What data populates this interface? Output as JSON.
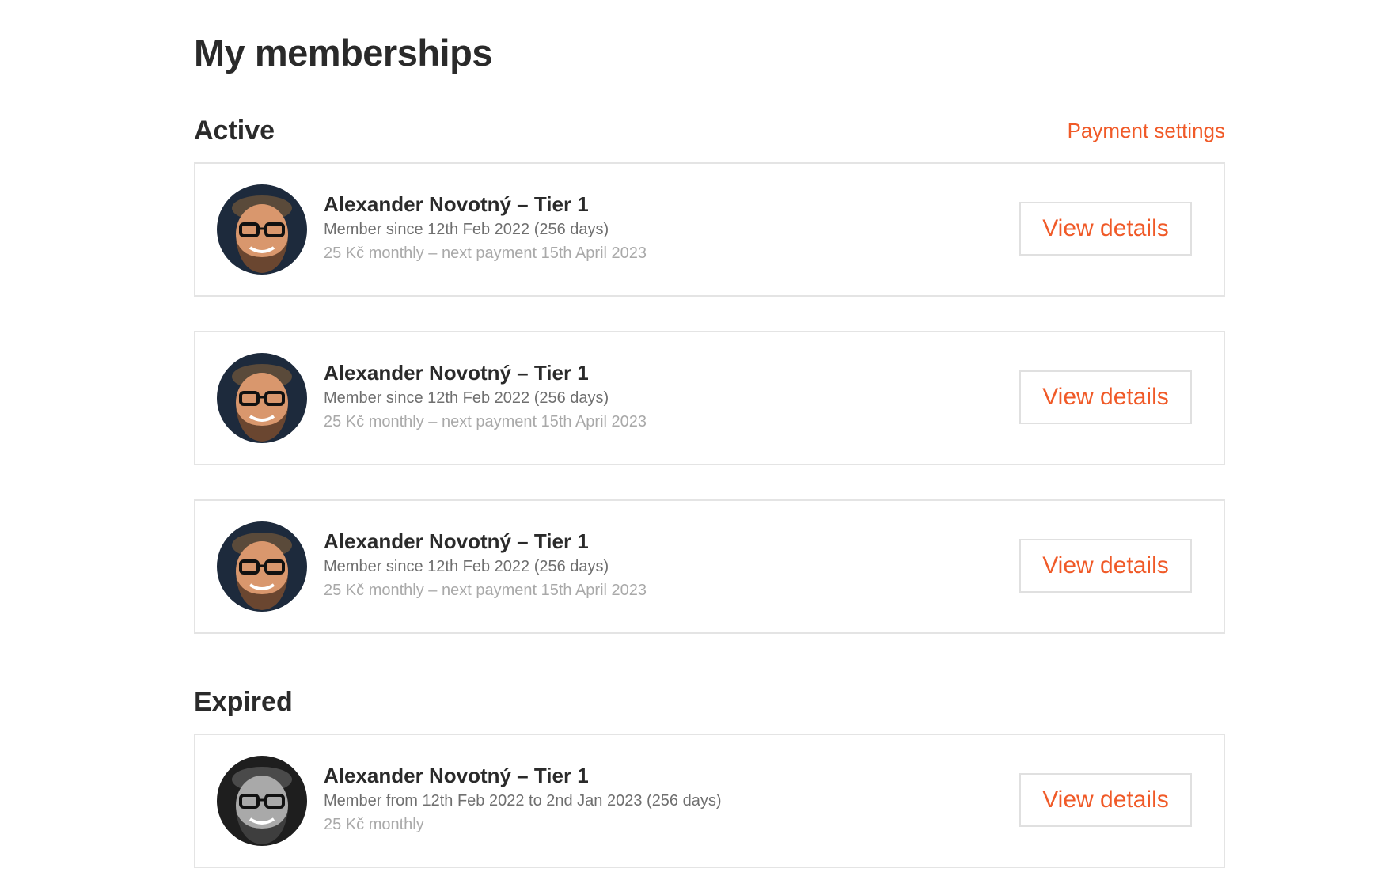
{
  "page_title": "My memberships",
  "active": {
    "title": "Active",
    "payment_settings_label": "Payment settings",
    "memberships": [
      {
        "name": "Alexander Novotný – Tier 1",
        "since": "Member since 12th Feb 2022 (256 days)",
        "payment": "25 Kč monthly – next payment 15th April 2023",
        "button_label": "View details"
      },
      {
        "name": "Alexander Novotný – Tier 1",
        "since": "Member since 12th Feb 2022 (256 days)",
        "payment": "25 Kč monthly – next payment 15th April 2023",
        "button_label": "View details"
      },
      {
        "name": "Alexander Novotný – Tier 1",
        "since": "Member since 12th Feb 2022 (256 days)",
        "payment": "25 Kč monthly – next payment 15th April 2023",
        "button_label": "View details"
      }
    ]
  },
  "expired": {
    "title": "Expired",
    "memberships": [
      {
        "name": "Alexander Novotný – Tier 1",
        "since": "Member from 12th Feb 2022 to 2nd Jan 2023 (256 days)",
        "payment": "25 Kč monthly",
        "button_label": "View details"
      }
    ]
  },
  "colors": {
    "accent": "#f05a28",
    "text_dark": "#2a2a2a",
    "text_muted": "#6f6f6f",
    "text_light": "#a9a9a9",
    "border": "#e4e4e4"
  },
  "icons": {
    "avatar_active": "avatar-photo-color",
    "avatar_expired": "avatar-photo-grayscale"
  }
}
